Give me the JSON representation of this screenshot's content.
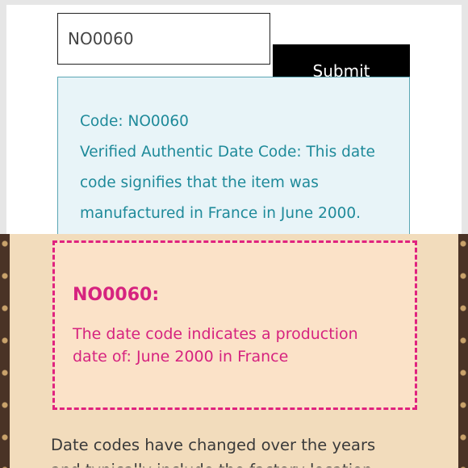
{
  "lookup": {
    "input_value": "NO0060",
    "submit_label": "Submit",
    "result": {
      "code_line": "Code: NO0060",
      "lines": [
        "Verified Authentic Date Code: This date",
        "code signifies that the item was",
        "manufactured in France in June 2000."
      ]
    }
  },
  "notice": {
    "title": "NO0060:",
    "text_lines": [
      "The date code indicates a production",
      "date of: June 2000 in France"
    ]
  },
  "footer": {
    "line1": "Date codes have changed over the years",
    "line2_partial": "and typically include the factory location"
  },
  "colors": {
    "result_text": "#1e8a9a",
    "notice_accent": "#e0237f",
    "bottom_bg": "#f2dcbc"
  }
}
